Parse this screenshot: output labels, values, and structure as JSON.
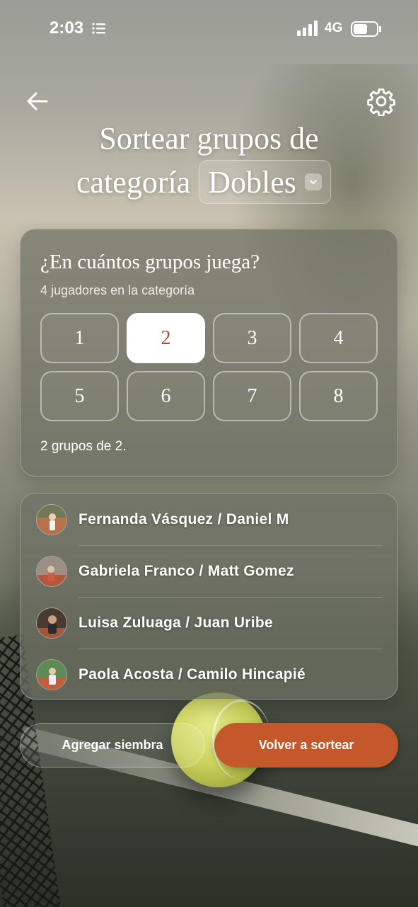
{
  "status_bar": {
    "time": "2:03",
    "network": "4G",
    "icons": [
      "list-icon",
      "signal-icon",
      "battery-icon"
    ]
  },
  "header": {
    "back_icon": "arrow-left-icon",
    "settings_icon": "gear-icon",
    "title_line1": "Sortear grupos de",
    "title_line2_prefix": "categoría",
    "category_value": "Dobles"
  },
  "groups": {
    "question": "¿En cuántos grupos juega?",
    "subtitle": "4 jugadores en la categoría",
    "options": [
      "1",
      "2",
      "3",
      "4",
      "5",
      "6",
      "7",
      "8"
    ],
    "selected": "2",
    "summary": "2 grupos de 2."
  },
  "players": [
    {
      "name": "Fernanda Vásquez / Daniel M"
    },
    {
      "name": "Gabriela Franco / Matt Gomez"
    },
    {
      "name": "Luisa Zuluaga / Juan Uribe"
    },
    {
      "name": "Paola Acosta / Camilo Hincapié"
    }
  ],
  "actions": {
    "add_seed": "Agregar siembra",
    "redraw": "Volver a sortear"
  },
  "colors": {
    "accent": "#c5582a",
    "selected_text": "#b8472b"
  }
}
